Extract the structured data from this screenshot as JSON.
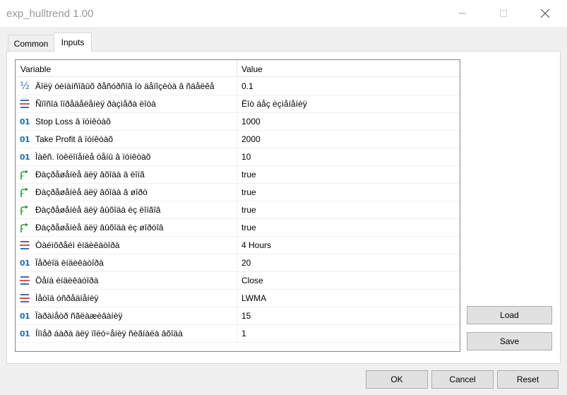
{
  "window": {
    "title": "exp_hulltrend 1.00",
    "minimize_glyph": "—",
    "maximize_glyph": "☐",
    "close_glyph": "✕"
  },
  "tabs": [
    {
      "label": "Common",
      "active": false
    },
    {
      "label": "Inputs",
      "active": true
    }
  ],
  "grid": {
    "header": {
      "variable": "Variable",
      "value": "Value"
    },
    "rows": [
      {
        "icon": "fraction-icon",
        "name": "Äîëÿ óèíàíñîâûõ ðåñóðñîâ îò äåïîçèòà â ñäåëêå",
        "value": "0.1"
      },
      {
        "icon": "enum-icon",
        "name": "Ñïîñîá îïðåäåëåíèÿ ðàçìåðà ëîòà",
        "value": "Ëîò áåç èçìåíåíèÿ"
      },
      {
        "icon": "integer-icon",
        "name": "Stop Loss â ïóíêòàõ",
        "value": "1000"
      },
      {
        "icon": "integer-icon",
        "name": "Take Profit â ïóíêòàõ",
        "value": "2000"
      },
      {
        "icon": "integer-icon",
        "name": "Ìàêñ. îòêëîíåíèå öåíû â ïóíêòàõ",
        "value": "10"
      },
      {
        "icon": "bool-icon",
        "name": "Ðàçðåøåíèå äëÿ âõîäà â ëîíã",
        "value": "true"
      },
      {
        "icon": "bool-icon",
        "name": "Ðàçðåøåíèå äëÿ âõîäà â øîðò",
        "value": "true"
      },
      {
        "icon": "bool-icon",
        "name": "Ðàçðåøåíèå äëÿ âûõîäà èç ëîíãîâ",
        "value": "true"
      },
      {
        "icon": "bool-icon",
        "name": "Ðàçðåøåíèå äëÿ âûõîäà èç øîðòîâ",
        "value": "true"
      },
      {
        "icon": "enum-icon",
        "name": "Òàéìôðåéì èíäèêàòîðà",
        "value": "4 Hours"
      },
      {
        "icon": "integer-icon",
        "name": "Ïåðèîä èíäèêàòîðà",
        "value": "20"
      },
      {
        "icon": "enum-icon",
        "name": "Öåíà èíäèêàòîðà",
        "value": "Close"
      },
      {
        "icon": "enum-icon",
        "name": "Ìåòîä óñðåäíåíèÿ",
        "value": "LWMA"
      },
      {
        "icon": "integer-icon",
        "name": "Ïàðàìåòð ñãëàæèâàíèÿ",
        "value": "15"
      },
      {
        "icon": "integer-icon",
        "name": "Íîìåð áàðà äëÿ ïîëó÷åíèÿ ñèãíàëà âõîäà",
        "value": "1"
      }
    ]
  },
  "side_buttons": {
    "load": "Load",
    "save": "Save"
  },
  "footer_buttons": {
    "ok": "OK",
    "cancel": "Cancel",
    "reset": "Reset"
  },
  "colors": {
    "accent_blue": "#1f6fb8",
    "bool_green": "#2e9b3a",
    "enum_blue": "#3b6fb6",
    "enum_red": "#e05050"
  }
}
